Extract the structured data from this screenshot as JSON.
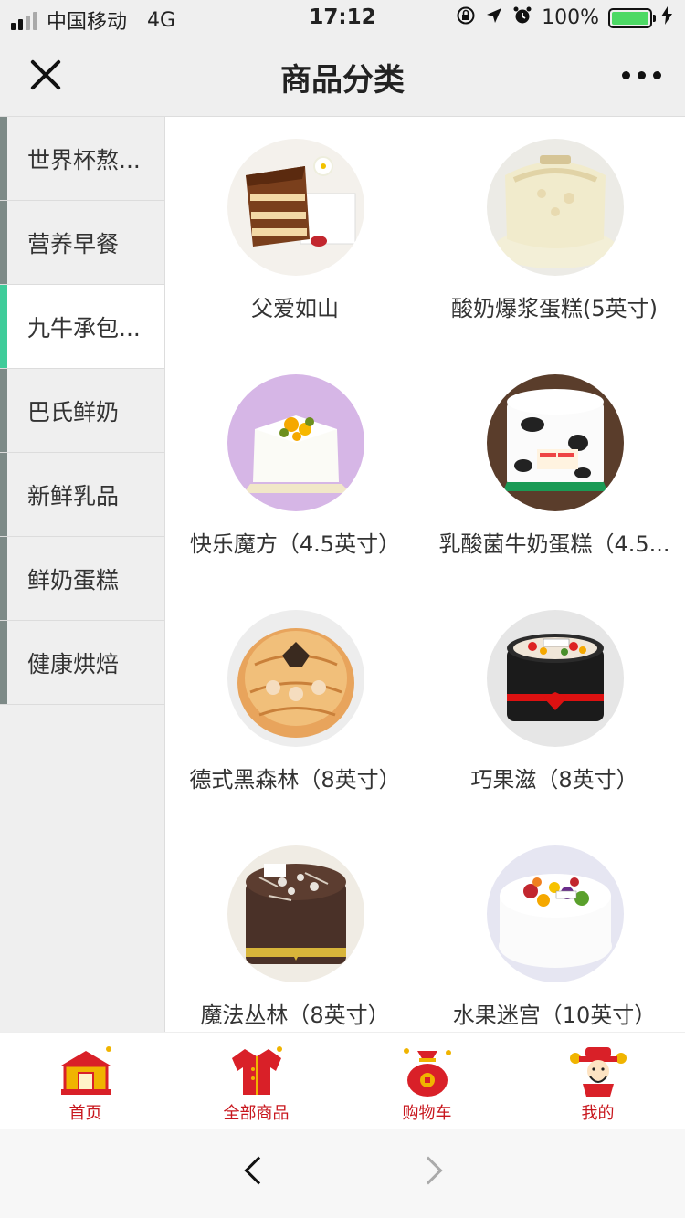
{
  "status_bar": {
    "carrier": "中国移动",
    "network": "4G",
    "time": "17:12",
    "battery": "100%",
    "battery_color": "#4cd964"
  },
  "nav": {
    "title": "商品分类"
  },
  "sidebar": {
    "active_color": "#3fcc9a",
    "items": [
      {
        "label": "世界杯熬..."
      },
      {
        "label": "营养早餐"
      },
      {
        "label": "九牛承包...",
        "active": true
      },
      {
        "label": "巴氏鲜奶"
      },
      {
        "label": "新鲜乳品"
      },
      {
        "label": "鲜奶蛋糕"
      },
      {
        "label": "健康烘焙"
      }
    ]
  },
  "products": [
    {
      "name": "父爱如山",
      "image": "cake-photo"
    },
    {
      "name": "酸奶爆浆蛋糕(5英寸)",
      "image": "cake-photo"
    },
    {
      "name": "快乐魔方（4.5英寸）",
      "image": "cake-photo"
    },
    {
      "name": "乳酸菌牛奶蛋糕（4.5...",
      "image": "cake-photo"
    },
    {
      "name": "德式黑森林（8英寸）",
      "image": "cake-photo"
    },
    {
      "name": "巧果滋（8英寸）",
      "image": "cake-photo"
    },
    {
      "name": "魔法丛林（8英寸）",
      "image": "cake-photo"
    },
    {
      "name": "水果迷宫（10英寸）",
      "image": "cake-photo"
    }
  ],
  "tabbar": {
    "color": "#c8161d",
    "tabs": [
      {
        "label": "首页",
        "icon": "house-icon"
      },
      {
        "label": "全部商品",
        "icon": "jacket-icon"
      },
      {
        "label": "购物车",
        "icon": "money-bag-icon"
      },
      {
        "label": "我的",
        "icon": "god-of-wealth-icon"
      }
    ]
  }
}
